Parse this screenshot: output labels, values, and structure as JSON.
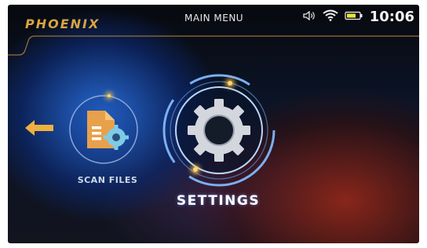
{
  "header": {
    "logo_text": "PHOENIX",
    "title": "MAIN MENU",
    "time": "10:06",
    "status_icons": [
      "speaker-icon",
      "wifi-icon",
      "battery-icon"
    ]
  },
  "menu": {
    "back_icon": "arrow-left-icon",
    "items": [
      {
        "label": "SCAN FILES",
        "icon": "document-gear-icon",
        "selected": false
      },
      {
        "label": "SETTINGS",
        "icon": "gear-icon",
        "selected": true
      }
    ]
  },
  "colors": {
    "accent": "#d9a441",
    "arrow": "#f0b040",
    "ring": "#7fb7ff",
    "document": "#e9a04a",
    "gear": "#7ecbe8"
  }
}
